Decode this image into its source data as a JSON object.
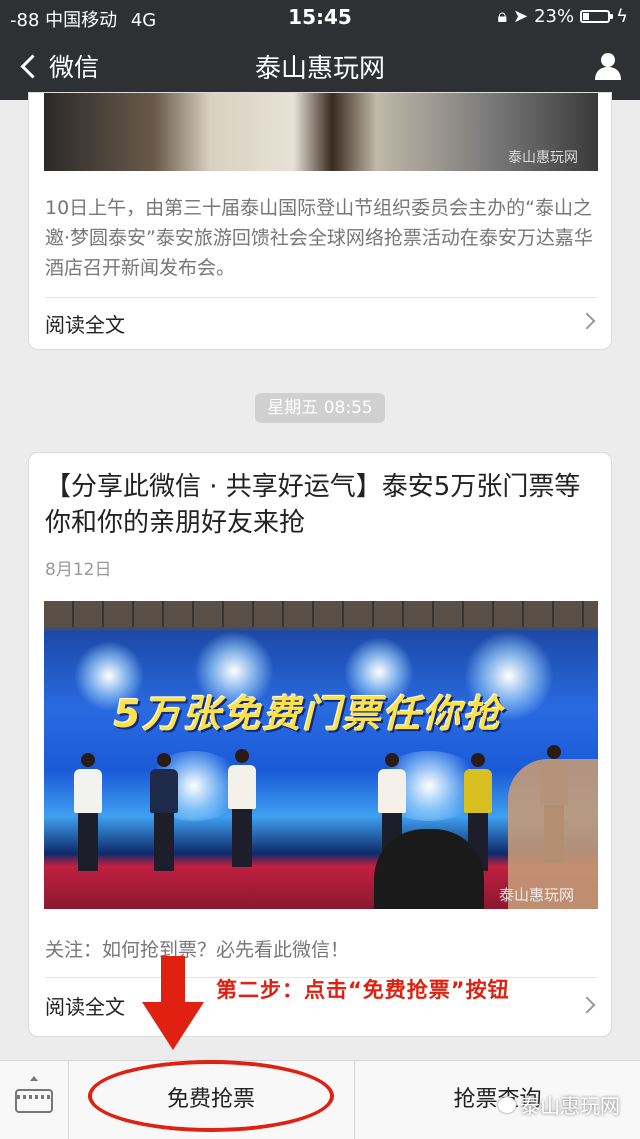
{
  "status_bar": {
    "carrier": "-88 中国移动",
    "network": "4G",
    "time": "15:45",
    "battery_percent": "23%",
    "battery_level": 0.23
  },
  "nav": {
    "back_label": "微信",
    "title": "泰山惠玩网"
  },
  "card1": {
    "watermark": "泰山惠玩网",
    "summary": "10日上午，由第三十届泰山国际登山节组织委员会主办的“泰山之邀·梦圆泰安”泰安旅游回馈社会全球网络抢票活动在泰安万达嘉华酒店召开新闻发布会。",
    "read_more": "阅读全文"
  },
  "timestamp": "星期五 08:55",
  "card2": {
    "title": "【分享此微信 · 共享好运气】泰安5万张门票等你和你的亲朋好友来抢",
    "date": "8月12日",
    "banner_text": "5万张免费门票任你抢",
    "watermark": "泰山惠玩网",
    "note": "关注：如何抢到票？必先看此微信！",
    "read_more": "阅读全文"
  },
  "annotation": "第二步：点击“免费抢票”按钮",
  "bottom_menu": {
    "item1": "免费抢票",
    "item2": "抢票查询"
  },
  "brand_watermark": "泰山惠玩网",
  "colors": {
    "nav_bg": "#2f3033",
    "annotation_red": "#e02010"
  }
}
